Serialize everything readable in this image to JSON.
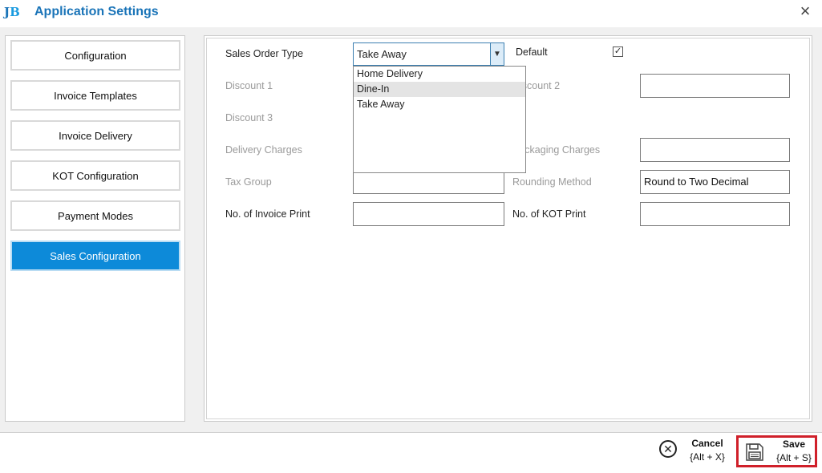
{
  "window": {
    "logo_text": "JB",
    "title": "Application Settings",
    "close_glyph": "×"
  },
  "sidebar": {
    "items": [
      {
        "label": "Configuration",
        "active": false
      },
      {
        "label": "Invoice Templates",
        "active": false
      },
      {
        "label": "Invoice Delivery",
        "active": false
      },
      {
        "label": "KOT Configuration",
        "active": false
      },
      {
        "label": "Payment Modes",
        "active": false
      },
      {
        "label": "Sales Configuration",
        "active": true
      }
    ]
  },
  "form": {
    "sales_order_type": {
      "label": "Sales Order Type",
      "value": "Take Away",
      "options": [
        "Home Delivery",
        "Dine-In",
        "Take Away"
      ],
      "highlighted": "Dine-In"
    },
    "default": {
      "label": "Default",
      "checked": true,
      "check_glyph": "✓"
    },
    "discount1": {
      "label": "Discount 1",
      "value": ""
    },
    "discount2": {
      "label": "Discount 2",
      "value": ""
    },
    "discount3": {
      "label": "Discount 3",
      "value": ""
    },
    "delivery_charges": {
      "label": "Delivery Charges",
      "value": ""
    },
    "packaging_charges": {
      "label": "Packaging Charges",
      "value": ""
    },
    "tax_group": {
      "label": "Tax Group",
      "value": ""
    },
    "rounding_method": {
      "label": "Rounding Method",
      "value": "Round to Two Decimal"
    },
    "invoice_print": {
      "label": "No. of Invoice Print",
      "value": ""
    },
    "kot_print": {
      "label": "No. of KOT Print",
      "value": ""
    }
  },
  "footer": {
    "cancel": {
      "label": "Cancel",
      "shortcut": "{Alt + X}"
    },
    "save": {
      "label": "Save",
      "shortcut": "{Alt + S}"
    }
  },
  "colors": {
    "accent": "#0d8ad9",
    "title": "#1a74b8",
    "save_highlight": "#d0202a"
  }
}
